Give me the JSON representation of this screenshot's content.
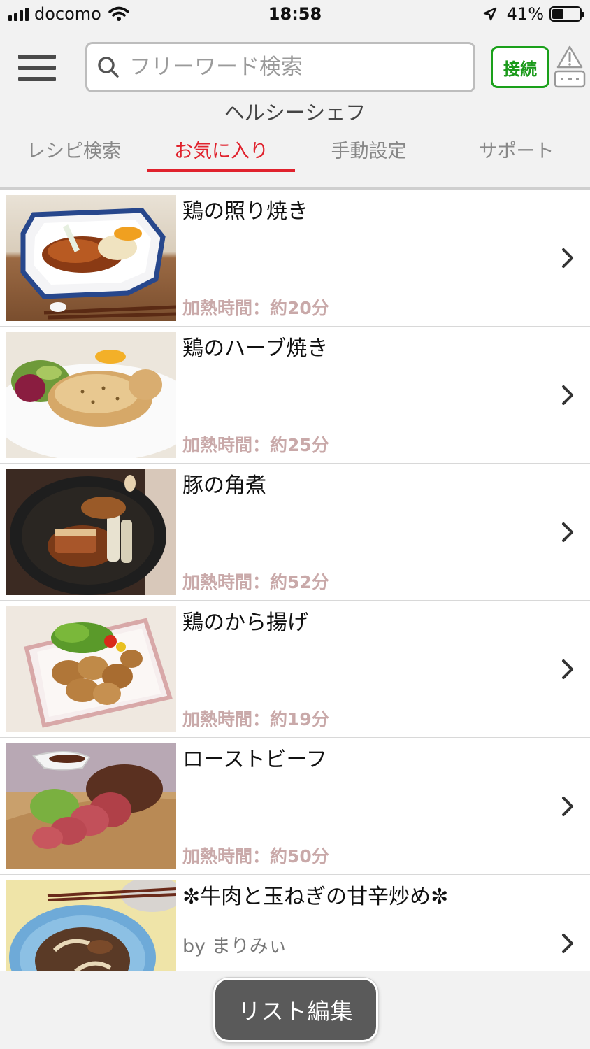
{
  "status_bar": {
    "carrier": "docomo",
    "time": "18:58",
    "battery_percent": "41%",
    "battery_level": 0.41
  },
  "header": {
    "search_placeholder": "フリーワード検索",
    "connect_label": "接続",
    "app_title": "ヘルシーシェフ"
  },
  "tabs": [
    {
      "label": "レシピ検索",
      "active": false
    },
    {
      "label": "お気に入り",
      "active": true
    },
    {
      "label": "手動設定",
      "active": false
    },
    {
      "label": "サポート",
      "active": false
    }
  ],
  "recipes": [
    {
      "name": "鶏の照り焼き",
      "meta": "加熱時間：約20分",
      "image": "teriyaki-chicken-photo"
    },
    {
      "name": "鶏のハーブ焼き",
      "meta": "加熱時間：約25分",
      "image": "herb-chicken-photo"
    },
    {
      "name": "豚の角煮",
      "meta": "加熱時間：約52分",
      "image": "braised-pork-photo"
    },
    {
      "name": "鶏のから揚げ",
      "meta": "加熱時間：約19分",
      "image": "fried-chicken-photo"
    },
    {
      "name": "ローストビーフ",
      "meta": "加熱時間：約50分",
      "image": "roast-beef-photo"
    },
    {
      "name": "✼牛肉と玉ねぎの甘辛炒め✼",
      "meta": "by まりみぃ",
      "image": "beef-onion-photo"
    }
  ],
  "footer": {
    "edit_button_label": "リスト編集"
  },
  "colors": {
    "accent_red": "#e0222d",
    "connect_green": "#1aa01a",
    "meta_pink": "#c9a9a9"
  }
}
